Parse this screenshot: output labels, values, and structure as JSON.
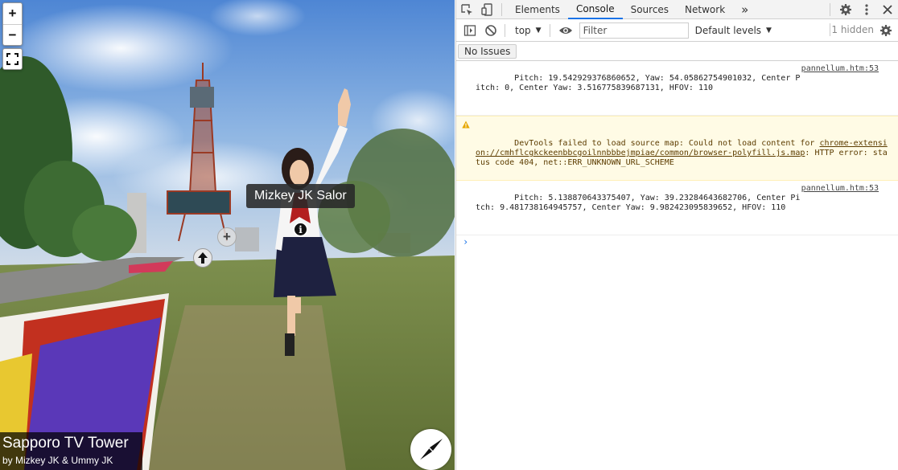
{
  "viewer": {
    "zoom_in": "+",
    "zoom_out": "−",
    "tooltip": "Mizkey JK Salor",
    "info_hotspot_symbol": "i",
    "add_hotspot_symbol": "+",
    "title": "Sapporo TV Tower",
    "author": "by Mizkey JK & Ummy JK"
  },
  "devtools": {
    "tabs": [
      {
        "label": "Elements",
        "active": false
      },
      {
        "label": "Console",
        "active": true
      },
      {
        "label": "Sources",
        "active": false
      },
      {
        "label": "Network",
        "active": false
      }
    ],
    "more_tabs": "»",
    "toolbar": {
      "context": "top",
      "filter_placeholder": "Filter",
      "filter_value": "",
      "levels": "Default levels",
      "hidden": "1 hidden"
    },
    "issues_button": "No Issues",
    "messages": [
      {
        "type": "log",
        "text": "Pitch: 19.542929376860652, Yaw: 54.05862754901032, Center Pitch: 0, Center Yaw: 3.516775839687131, HFOV: 110",
        "source": "pannellum.htm:53"
      },
      {
        "type": "warning",
        "text_before": "DevTools failed to load source map: Could not load content for ",
        "link": "chrome-extension://cmhflcgkckeenbbcgoilnnbbbejmpiae/common/browser-polyfill.js.map",
        "text_after": ": HTTP error: status code 404, net::ERR_UNKNOWN_URL_SCHEME"
      },
      {
        "type": "log",
        "text": "Pitch: 5.138870643375407, Yaw: 39.23284643682706, Center Pitch: 9.481738164945757, Center Yaw: 9.982423095839652, HFOV: 110",
        "source": "pannellum.htm:53"
      }
    ],
    "prompt": "›"
  }
}
